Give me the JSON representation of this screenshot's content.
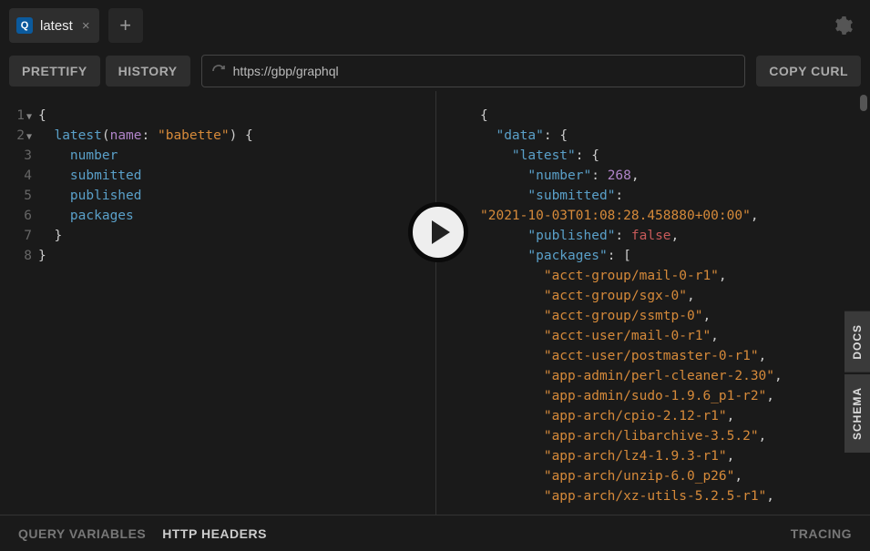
{
  "tabs": {
    "active_badge": "Q",
    "active_title": "latest"
  },
  "toolbar": {
    "prettify": "PRETTIFY",
    "history": "HISTORY",
    "copy_curl": "COPY CURL",
    "url": "https://gbp/graphql"
  },
  "editor": {
    "lines": [
      "1",
      "2",
      "3",
      "4",
      "5",
      "6",
      "7",
      "8"
    ],
    "query": {
      "root": "latest",
      "arg_name": "name",
      "arg_value": "\"babette\"",
      "fields": [
        "number",
        "submitted",
        "published",
        "packages"
      ]
    }
  },
  "result": {
    "data_key": "\"data\"",
    "latest_key": "\"latest\"",
    "number_key": "\"number\"",
    "number_val": "268",
    "submitted_key": "\"submitted\"",
    "submitted_val": "\"2021-10-03T01:08:28.458880+00:00\"",
    "published_key": "\"published\"",
    "published_val": "false",
    "packages_key": "\"packages\"",
    "packages": [
      "\"acct-group/mail-0-r1\"",
      "\"acct-group/sgx-0\"",
      "\"acct-group/ssmtp-0\"",
      "\"acct-user/mail-0-r1\"",
      "\"acct-user/postmaster-0-r1\"",
      "\"app-admin/perl-cleaner-2.30\"",
      "\"app-admin/sudo-1.9.6_p1-r2\"",
      "\"app-arch/cpio-2.12-r1\"",
      "\"app-arch/libarchive-3.5.2\"",
      "\"app-arch/lz4-1.9.3-r1\"",
      "\"app-arch/unzip-6.0_p26\"",
      "\"app-arch/xz-utils-5.2.5-r1\""
    ]
  },
  "side": {
    "docs": "DOCS",
    "schema": "SCHEMA"
  },
  "footer": {
    "query_vars": "QUERY VARIABLES",
    "http_headers": "HTTP HEADERS",
    "tracing": "TRACING"
  }
}
